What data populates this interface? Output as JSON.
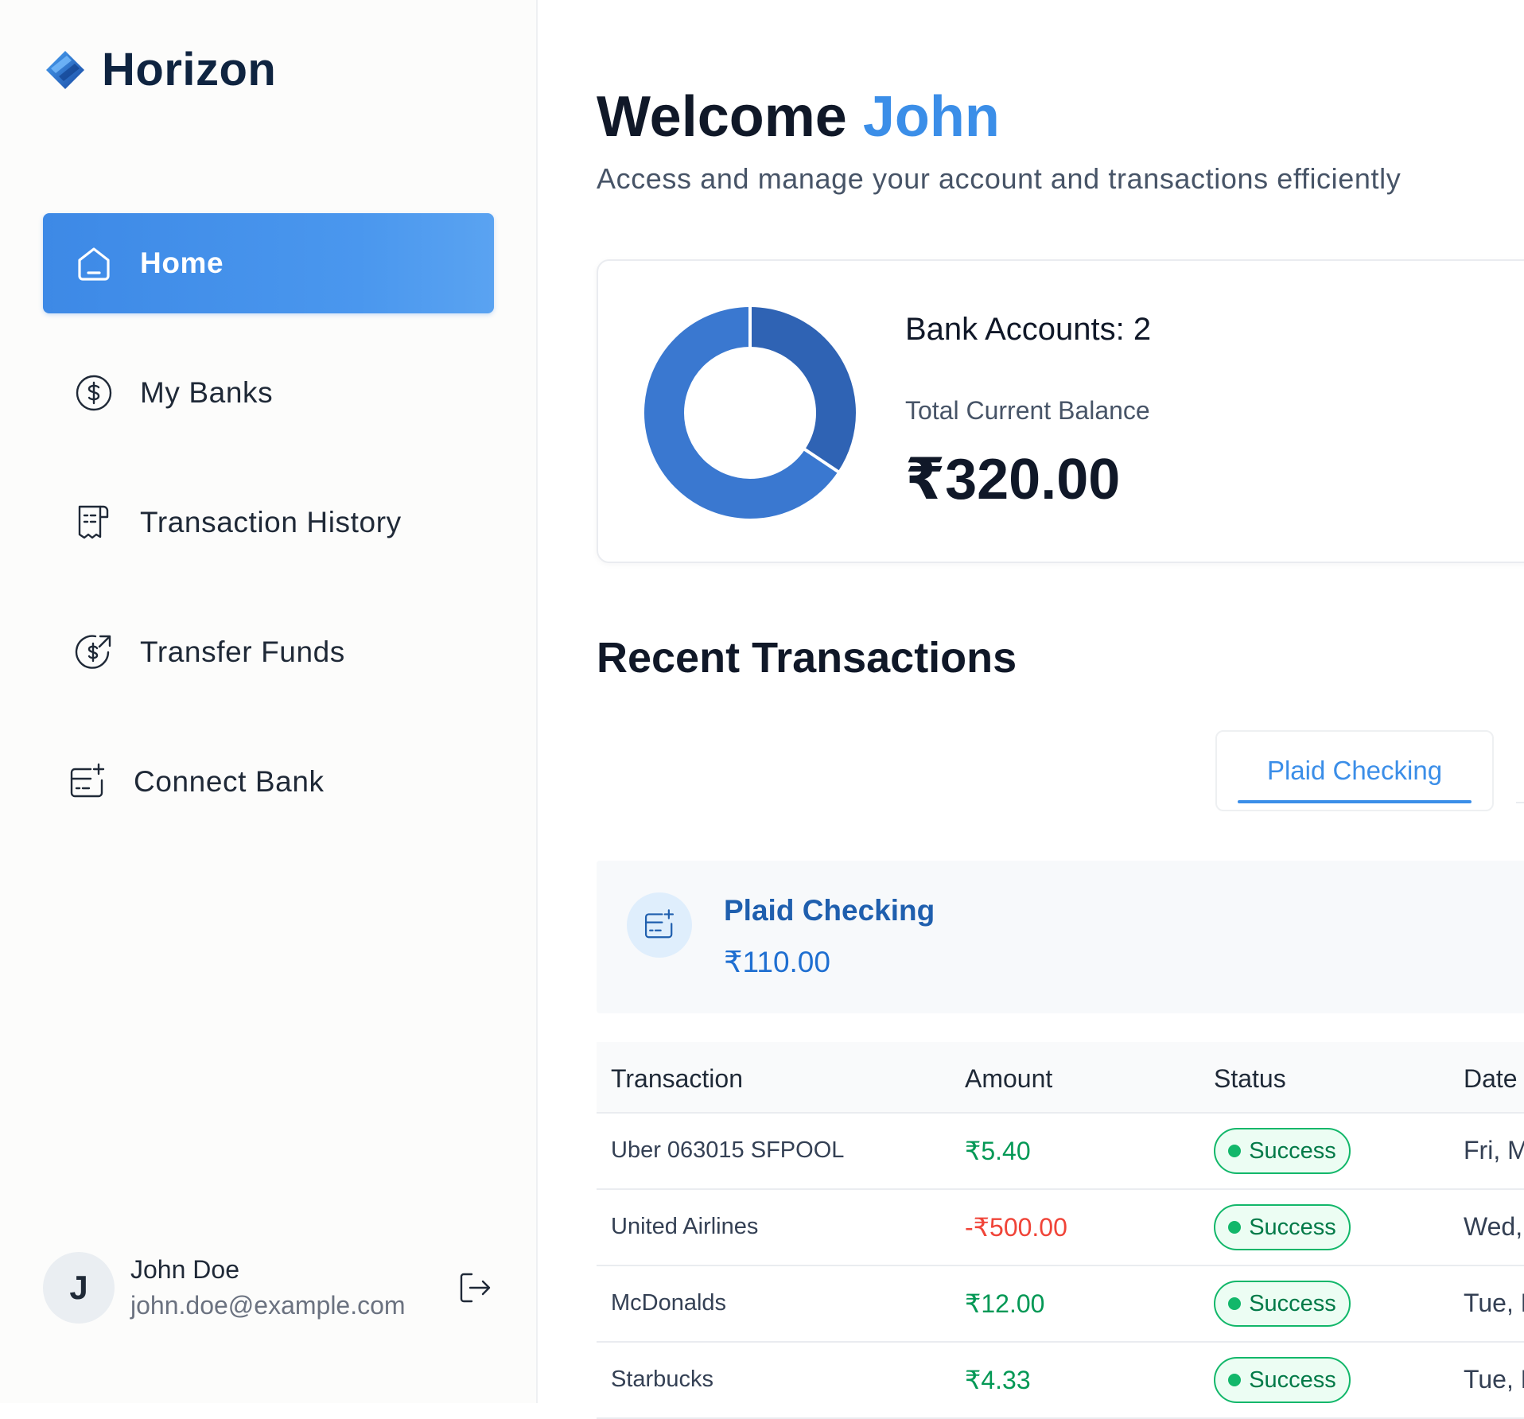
{
  "app": {
    "name": "Horizon"
  },
  "sidebar": {
    "items": [
      {
        "label": "Home",
        "icon": "home-icon",
        "active": true
      },
      {
        "label": "My Banks",
        "icon": "dollar-circle-icon",
        "active": false
      },
      {
        "label": "Transaction History",
        "icon": "receipt-icon",
        "active": false
      },
      {
        "label": "Transfer Funds",
        "icon": "money-send-icon",
        "active": false
      },
      {
        "label": "Connect Bank",
        "icon": "connect-bank-icon",
        "active": false
      }
    ],
    "user": {
      "initial": "J",
      "name": "John Doe",
      "email": "john.doe@example.com"
    }
  },
  "header": {
    "welcome": "Welcome",
    "user_first_name": "John",
    "subtitle": "Access and manage your account and transactions efficiently"
  },
  "balance": {
    "bank_accounts_label": "Bank Accounts: 2",
    "total_label": "Total Current Balance",
    "total_amount": "₹320.00",
    "donut": {
      "segments": [
        {
          "value": 110,
          "color": "#2f63b4"
        },
        {
          "value": 210,
          "color": "#3a78d0"
        }
      ]
    }
  },
  "transactions": {
    "title": "Recent Transactions",
    "tabs": [
      {
        "label": "Plaid Checking",
        "active": true
      }
    ],
    "account": {
      "name": "Plaid Checking",
      "amount": "₹110.00"
    },
    "columns": [
      "Transaction",
      "Amount",
      "Status",
      "Date"
    ],
    "rows": [
      {
        "name": "Uber 063015 SFPOOL",
        "amount": "₹5.40",
        "type": "pos",
        "status": "Success",
        "date": "Fri, M"
      },
      {
        "name": "United Airlines",
        "amount": "-₹500.00",
        "type": "neg",
        "status": "Success",
        "date": "Wed,"
      },
      {
        "name": "McDonalds",
        "amount": "₹12.00",
        "type": "pos",
        "status": "Success",
        "date": "Tue, N"
      },
      {
        "name": "Starbucks",
        "amount": "₹4.33",
        "type": "pos",
        "status": "Success",
        "date": "Tue, N"
      }
    ]
  },
  "colors": {
    "accent": "#3b8ee8",
    "success": "#12b76a",
    "negative": "#f04438",
    "positive": "#039855"
  }
}
